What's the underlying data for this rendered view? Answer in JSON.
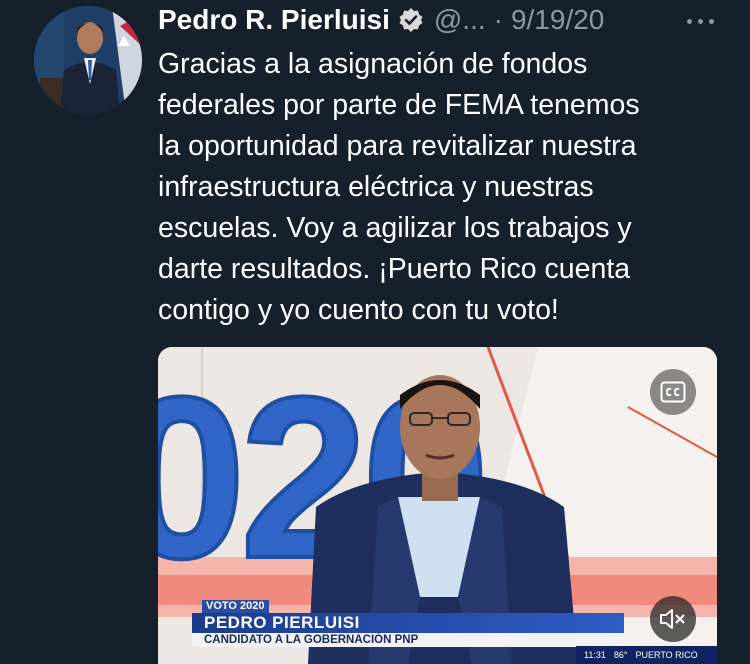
{
  "tweet": {
    "author_name": "Pedro R. Pierluisi",
    "handle": "@...",
    "separator": "·",
    "date": "9/19/20",
    "text": "Gracias a la asignación de fondos\nfederales por parte de FEMA tenemos\nla oportunidad para revitalizar nuestra\ninfraestructura eléctrica y nuestras\nescuelas. Voy a agilizar los trabajos y\ndarte resultados. ¡Puerto Rico cuenta\ncontigo y yo cuento con tu voto!"
  },
  "video": {
    "backdrop_text": "020",
    "overlay_tag": "VOTO 2020",
    "overlay_name": "PEDRO PIERLUISI",
    "overlay_title": "CANDIDATO A LA GOBERNACIÓN PNP",
    "ticker_time": "11:31",
    "ticker_temp": "86°",
    "ticker_station": "PUERTO RICO",
    "cc_icon": "closed-captions-icon",
    "mute_icon": "muted-speaker-icon"
  },
  "colors": {
    "background": "#15202b",
    "text_primary": "#ffffff",
    "text_secondary": "#8b98a5",
    "verified": "#d9d9d9"
  }
}
